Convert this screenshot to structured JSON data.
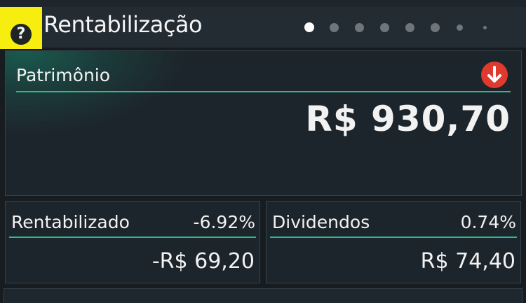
{
  "header": {
    "help_icon": "?",
    "title": "Rentabilização",
    "pager": {
      "count": 8,
      "active_index": 0,
      "active_color": "#ffffff",
      "inactive_color": "#6f767b"
    }
  },
  "patrimonio": {
    "label": "Patrimônio",
    "trend_icon": "arrow-down-circle-icon",
    "trend_color": "#e03a2f",
    "value": "R$ 930,70"
  },
  "rentabilizado": {
    "label": "Rentabilizado",
    "percent": "-6.92%",
    "value": "-R$ 69,20"
  },
  "dividendos": {
    "label": "Dividendos",
    "percent": "0.74%",
    "value": "R$ 74,40"
  },
  "colors": {
    "accent": "#2fb893",
    "highlight": "#f7ee0f",
    "background": "#171c21",
    "card": "#1c252c"
  }
}
